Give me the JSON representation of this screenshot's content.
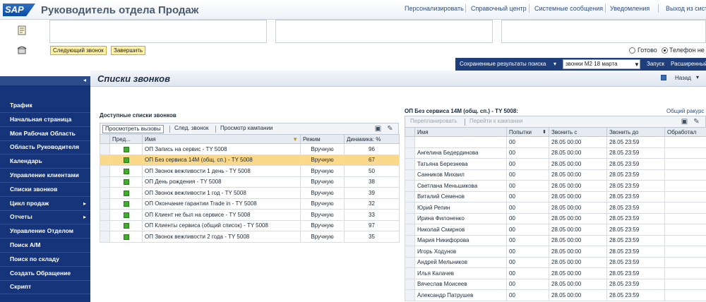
{
  "header": {
    "logo": "SAP",
    "title": "Руководитель отдела Продаж",
    "links": [
      "Персонализировать",
      "Справочный центр",
      "Системные сообщения",
      "Уведомления",
      "Выход из системы"
    ]
  },
  "cti": {
    "next_call_label": "Следующий звонок",
    "finish_label": "Завершить",
    "status_ready": "Готово",
    "status_phone": "Телефон не свободен"
  },
  "searchbar": {
    "saved_results_label": "Сохраненные результаты поиска",
    "selected_search": "звонки М2 18 марта",
    "run_label": "Запуск",
    "extended_label": "Расширенный"
  },
  "nav": {
    "items": [
      {
        "label": "Трафик",
        "has_children": false
      },
      {
        "label": "Начальная страница",
        "has_children": false
      },
      {
        "label": "Моя Рабочая Область",
        "has_children": false
      },
      {
        "label": "Область Руководителя",
        "has_children": false
      },
      {
        "label": "Календарь",
        "has_children": false
      },
      {
        "label": "Управление клиентами",
        "has_children": false
      },
      {
        "label": "Списки звонков",
        "has_children": false
      },
      {
        "label": "Цикл продаж",
        "has_children": true
      },
      {
        "label": "Отчеты",
        "has_children": true
      },
      {
        "label": "Управление Отделом",
        "has_children": false
      },
      {
        "label": "Поиск А/М",
        "has_children": false
      },
      {
        "label": "Поиск по складу",
        "has_children": false
      },
      {
        "label": "Создать Обращение",
        "has_children": false
      },
      {
        "label": "Скрипт",
        "has_children": false
      }
    ]
  },
  "page": {
    "title": "Списки звонков",
    "back_label": "Назад"
  },
  "left_panel": {
    "title": "Доступные списки звонков",
    "toolbar": {
      "view_calls": "Просмотреть вызовы",
      "next_call": "След. звонок",
      "view_campaign": "Просмотр кампании"
    },
    "columns": [
      "Пред...",
      "Имя",
      "Режим",
      "Динамика: %"
    ],
    "rows": [
      {
        "name": "ОП Запись на сервис - ТY 5008",
        "mode": "Вручную",
        "dynamic": "96",
        "highlight": false
      },
      {
        "name": "ОП Без сервиса 14М (общ. сп.) - ТY 5008",
        "mode": "Вручную",
        "dynamic": "67",
        "highlight": true
      },
      {
        "name": "ОП Звонок вежливости 1 день - ТY 5008",
        "mode": "Вручную",
        "dynamic": "50",
        "highlight": false
      },
      {
        "name": "ОП День рождения - ТY 5008",
        "mode": "Вручную",
        "dynamic": "38",
        "highlight": false
      },
      {
        "name": "ОП Звонок вежливости 1 год - ТY 5008",
        "mode": "Вручную",
        "dynamic": "39",
        "highlight": false
      },
      {
        "name": "ОП Окончание гарантии Trade in - ТY 5008",
        "mode": "Вручную",
        "dynamic": "32",
        "highlight": false
      },
      {
        "name": "ОП Клиент не был на сервисе - ТY 5008",
        "mode": "Вручную",
        "dynamic": "33",
        "highlight": false
      },
      {
        "name": "ОП Клиенты сервиса (общий список) - ТY 5008",
        "mode": "Вручную",
        "dynamic": "97",
        "highlight": false
      },
      {
        "name": "ОП Звонок вежливости 2 года - ТY 5008",
        "mode": "Вручную",
        "dynamic": "35",
        "highlight": false
      }
    ],
    "led_color": "#3fae2a",
    "highlight_color": "#fbd98a"
  },
  "right_panel": {
    "title": "ОП Без сервиса 14М (общ. сп.) - ТY 5008:",
    "link": "Общий ракурс",
    "toolbar": {
      "reschedule": "Перепланировать",
      "go_to_campaign": "Перейти к кампании"
    },
    "columns": [
      "Имя",
      "Попытки",
      "Звонить с",
      "Звонить до",
      "Обработал"
    ],
    "rows": [
      {
        "name": "",
        "attempts": "00",
        "from": "28.05 00:00",
        "to": "28.05 23:59",
        "handled": ""
      },
      {
        "name": "Ангелина Бедердинова",
        "attempts": "00",
        "from": "28.05 00:00",
        "to": "28.05 23:59",
        "handled": ""
      },
      {
        "name": "Татьяна Березнева",
        "attempts": "00",
        "from": "28.05 00:00",
        "to": "28.05 23:59",
        "handled": ""
      },
      {
        "name": "Санников Михаил",
        "attempts": "00",
        "from": "28.05 00:00",
        "to": "28.05 23:59",
        "handled": ""
      },
      {
        "name": "Светлана Меньшикова",
        "attempts": "00",
        "from": "28.05 00:00",
        "to": "28.05 23:59",
        "handled": ""
      },
      {
        "name": "Виталий Семенов",
        "attempts": "00",
        "from": "28.05 00:00",
        "to": "28.05 23:59",
        "handled": ""
      },
      {
        "name": "Юрий Репин",
        "attempts": "00",
        "from": "28.05 00:00",
        "to": "28.05 23:59",
        "handled": ""
      },
      {
        "name": "Ирина Филоненко",
        "attempts": "00",
        "from": "28.05 00:00",
        "to": "28.05 23:59",
        "handled": ""
      },
      {
        "name": "Николай Смирнов",
        "attempts": "00",
        "from": "28.05 00:00",
        "to": "28.05 23:59",
        "handled": ""
      },
      {
        "name": "Мария Никифорова",
        "attempts": "00",
        "from": "28.05 00:00",
        "to": "28.05 23:59",
        "handled": ""
      },
      {
        "name": "Игорь Ходунов",
        "attempts": "00",
        "from": "28.05 00:00",
        "to": "28.05 23:59",
        "handled": ""
      },
      {
        "name": "Андрей Мельников",
        "attempts": "00",
        "from": "28.05 00:00",
        "to": "28.05 23:59",
        "handled": ""
      },
      {
        "name": "Илья Калачев",
        "attempts": "00",
        "from": "28.05 00:00",
        "to": "28.05 23:59",
        "handled": ""
      },
      {
        "name": "Вячеслав Моисеев",
        "attempts": "00",
        "from": "28.05 00:00",
        "to": "28.05 23:59",
        "handled": ""
      },
      {
        "name": "Александр Патрушев",
        "attempts": "00",
        "from": "28.05 00:00",
        "to": "28.05 23:59",
        "handled": ""
      }
    ]
  }
}
